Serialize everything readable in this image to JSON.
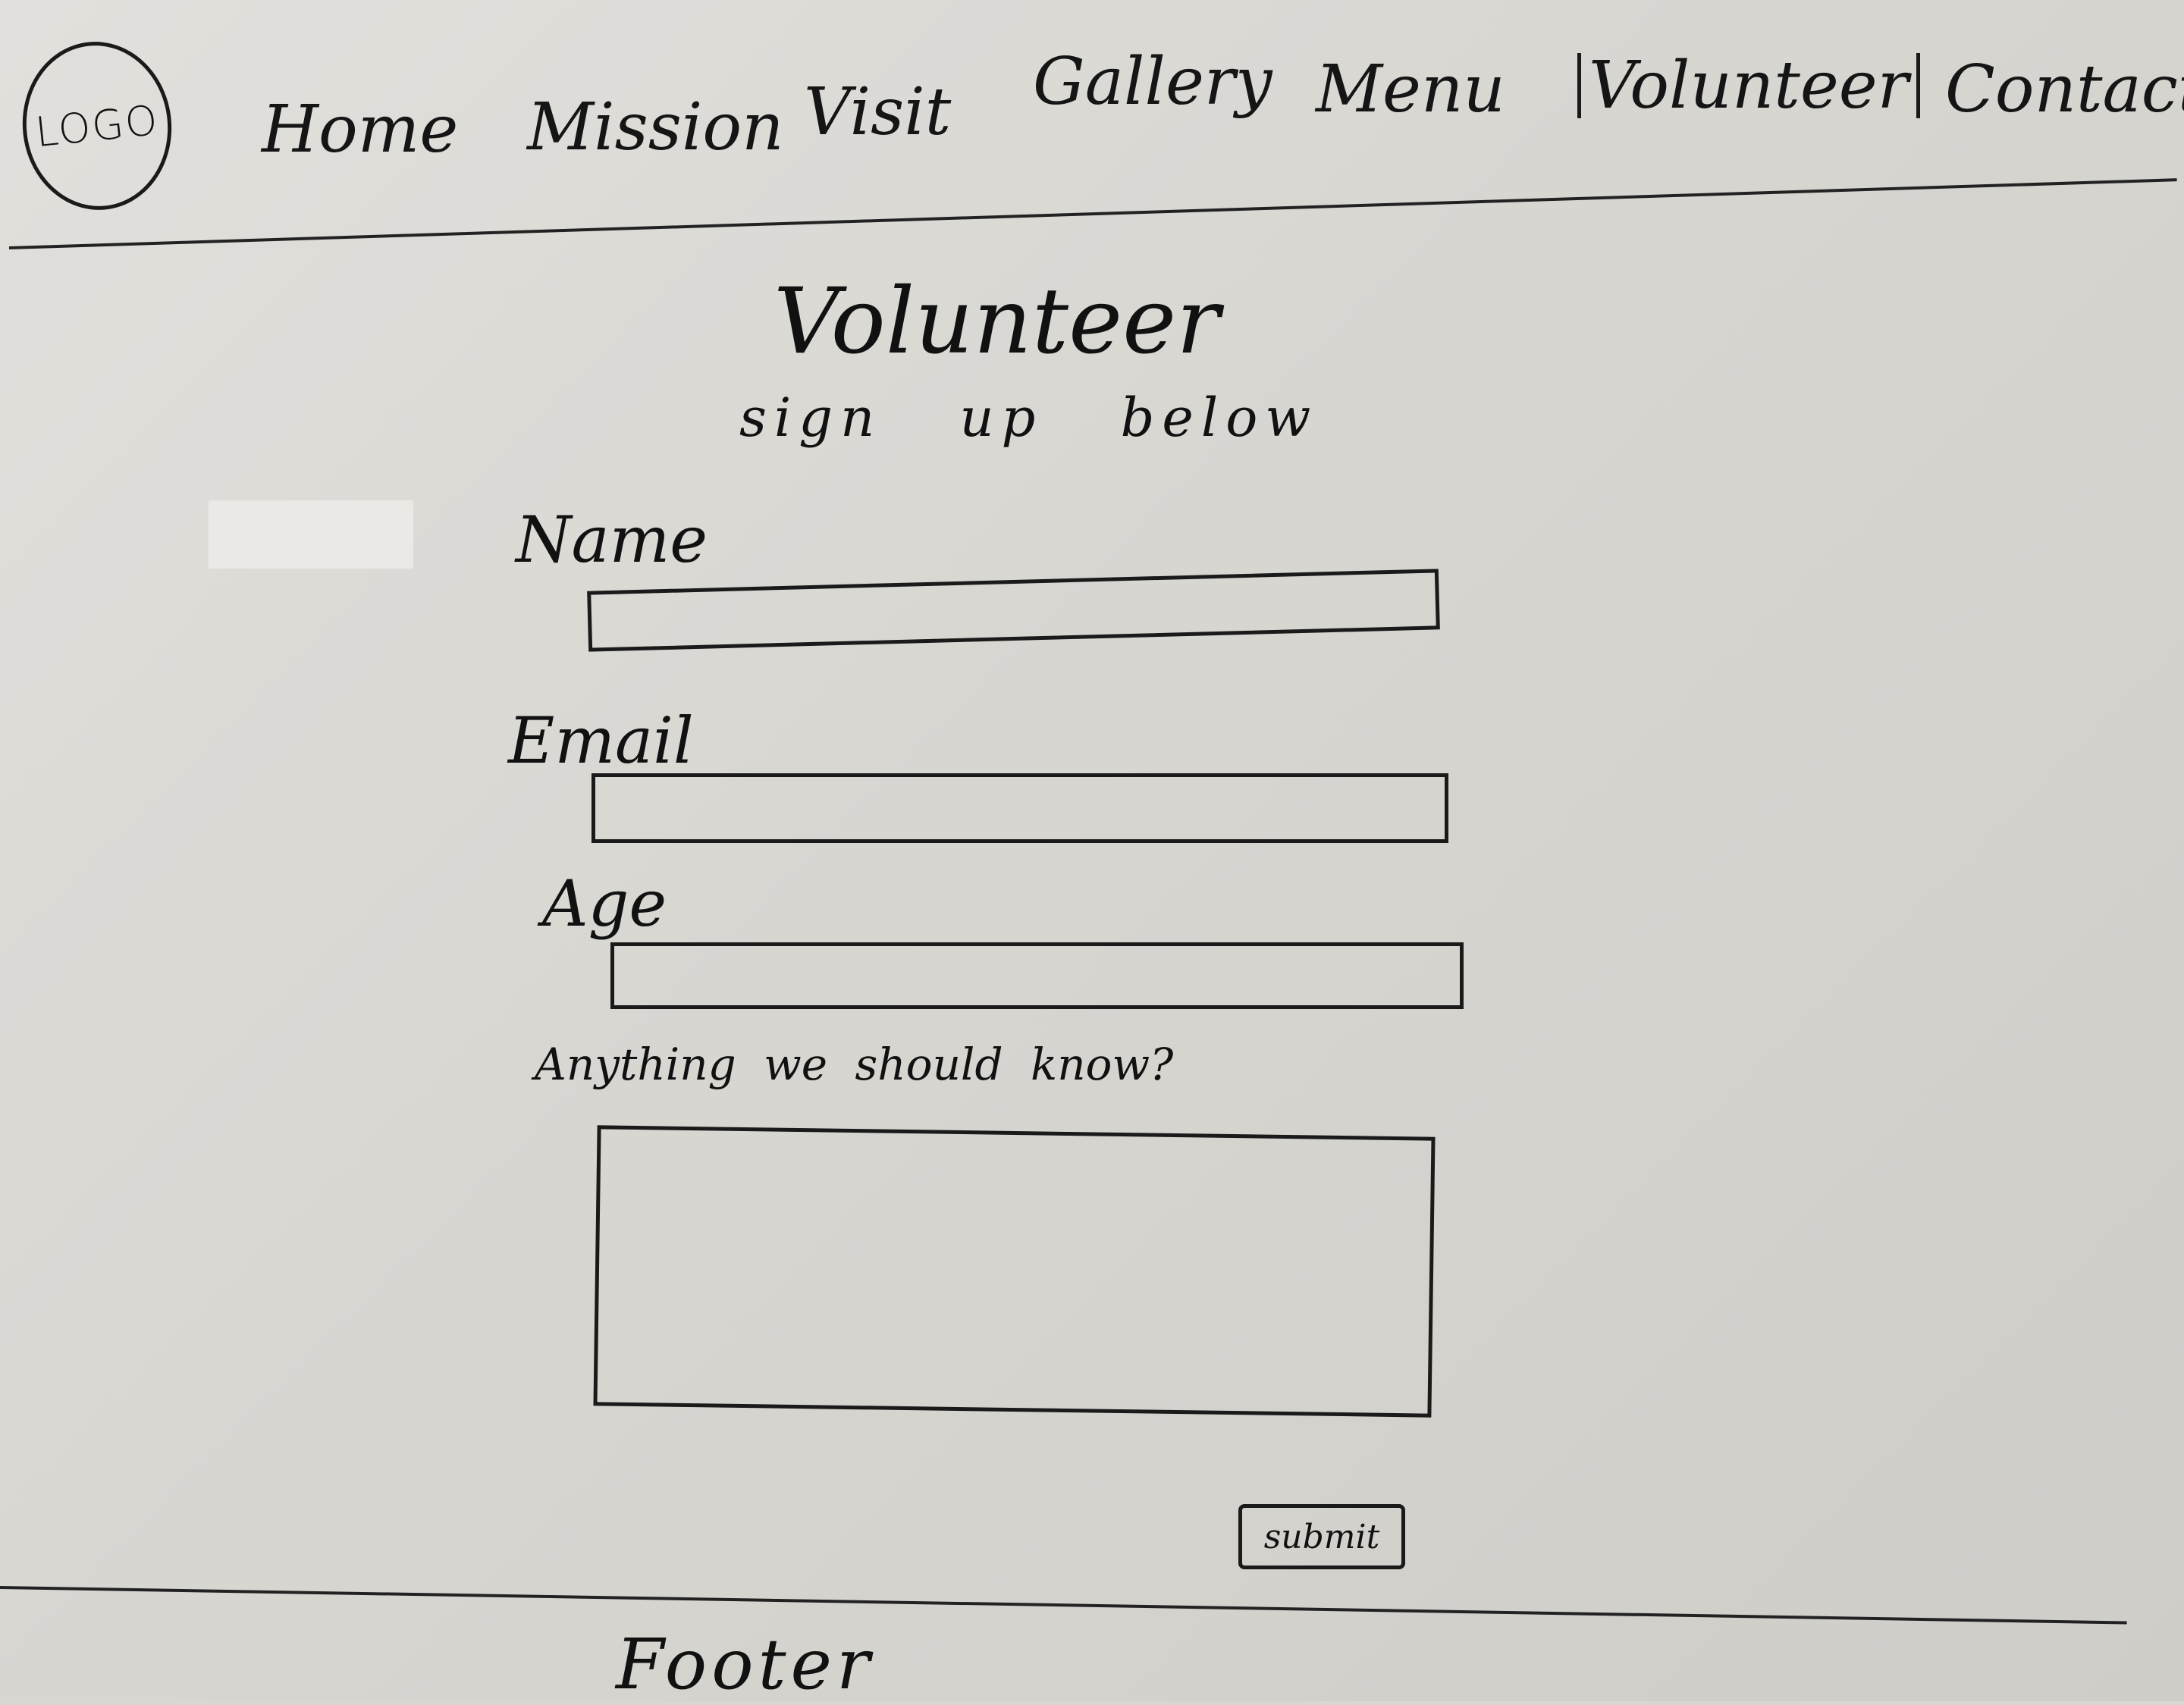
{
  "header": {
    "logo_text": "LOGO",
    "nav": [
      {
        "label": "Home"
      },
      {
        "label": "Mission"
      },
      {
        "label": "Visit"
      },
      {
        "label": "Gallery"
      },
      {
        "label": "Menu"
      },
      {
        "label": "Volunteer",
        "active": true
      },
      {
        "label": "Contact"
      }
    ]
  },
  "main": {
    "title": "Volunteer",
    "subtitle": "sign up below",
    "form": {
      "name_label": "Name",
      "email_label": "Email",
      "age_label": "Age",
      "notes_label": "Anything we should know?",
      "submit_label": "submit"
    }
  },
  "footer": {
    "label": "Footer"
  }
}
